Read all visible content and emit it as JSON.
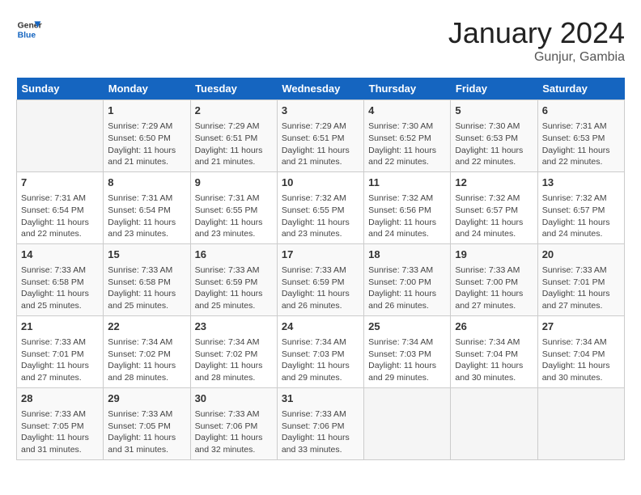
{
  "header": {
    "logo_line1": "General",
    "logo_line2": "Blue",
    "title": "January 2024",
    "subtitle": "Gunjur, Gambia"
  },
  "days_of_week": [
    "Sunday",
    "Monday",
    "Tuesday",
    "Wednesday",
    "Thursday",
    "Friday",
    "Saturday"
  ],
  "weeks": [
    [
      {
        "day": "",
        "content": ""
      },
      {
        "day": "1",
        "content": "Sunrise: 7:29 AM\nSunset: 6:50 PM\nDaylight: 11 hours\nand 21 minutes."
      },
      {
        "day": "2",
        "content": "Sunrise: 7:29 AM\nSunset: 6:51 PM\nDaylight: 11 hours\nand 21 minutes."
      },
      {
        "day": "3",
        "content": "Sunrise: 7:29 AM\nSunset: 6:51 PM\nDaylight: 11 hours\nand 21 minutes."
      },
      {
        "day": "4",
        "content": "Sunrise: 7:30 AM\nSunset: 6:52 PM\nDaylight: 11 hours\nand 22 minutes."
      },
      {
        "day": "5",
        "content": "Sunrise: 7:30 AM\nSunset: 6:53 PM\nDaylight: 11 hours\nand 22 minutes."
      },
      {
        "day": "6",
        "content": "Sunrise: 7:31 AM\nSunset: 6:53 PM\nDaylight: 11 hours\nand 22 minutes."
      }
    ],
    [
      {
        "day": "7",
        "content": "Sunrise: 7:31 AM\nSunset: 6:54 PM\nDaylight: 11 hours\nand 22 minutes."
      },
      {
        "day": "8",
        "content": "Sunrise: 7:31 AM\nSunset: 6:54 PM\nDaylight: 11 hours\nand 23 minutes."
      },
      {
        "day": "9",
        "content": "Sunrise: 7:31 AM\nSunset: 6:55 PM\nDaylight: 11 hours\nand 23 minutes."
      },
      {
        "day": "10",
        "content": "Sunrise: 7:32 AM\nSunset: 6:55 PM\nDaylight: 11 hours\nand 23 minutes."
      },
      {
        "day": "11",
        "content": "Sunrise: 7:32 AM\nSunset: 6:56 PM\nDaylight: 11 hours\nand 24 minutes."
      },
      {
        "day": "12",
        "content": "Sunrise: 7:32 AM\nSunset: 6:57 PM\nDaylight: 11 hours\nand 24 minutes."
      },
      {
        "day": "13",
        "content": "Sunrise: 7:32 AM\nSunset: 6:57 PM\nDaylight: 11 hours\nand 24 minutes."
      }
    ],
    [
      {
        "day": "14",
        "content": "Sunrise: 7:33 AM\nSunset: 6:58 PM\nDaylight: 11 hours\nand 25 minutes."
      },
      {
        "day": "15",
        "content": "Sunrise: 7:33 AM\nSunset: 6:58 PM\nDaylight: 11 hours\nand 25 minutes."
      },
      {
        "day": "16",
        "content": "Sunrise: 7:33 AM\nSunset: 6:59 PM\nDaylight: 11 hours\nand 25 minutes."
      },
      {
        "day": "17",
        "content": "Sunrise: 7:33 AM\nSunset: 6:59 PM\nDaylight: 11 hours\nand 26 minutes."
      },
      {
        "day": "18",
        "content": "Sunrise: 7:33 AM\nSunset: 7:00 PM\nDaylight: 11 hours\nand 26 minutes."
      },
      {
        "day": "19",
        "content": "Sunrise: 7:33 AM\nSunset: 7:00 PM\nDaylight: 11 hours\nand 27 minutes."
      },
      {
        "day": "20",
        "content": "Sunrise: 7:33 AM\nSunset: 7:01 PM\nDaylight: 11 hours\nand 27 minutes."
      }
    ],
    [
      {
        "day": "21",
        "content": "Sunrise: 7:33 AM\nSunset: 7:01 PM\nDaylight: 11 hours\nand 27 minutes."
      },
      {
        "day": "22",
        "content": "Sunrise: 7:34 AM\nSunset: 7:02 PM\nDaylight: 11 hours\nand 28 minutes."
      },
      {
        "day": "23",
        "content": "Sunrise: 7:34 AM\nSunset: 7:02 PM\nDaylight: 11 hours\nand 28 minutes."
      },
      {
        "day": "24",
        "content": "Sunrise: 7:34 AM\nSunset: 7:03 PM\nDaylight: 11 hours\nand 29 minutes."
      },
      {
        "day": "25",
        "content": "Sunrise: 7:34 AM\nSunset: 7:03 PM\nDaylight: 11 hours\nand 29 minutes."
      },
      {
        "day": "26",
        "content": "Sunrise: 7:34 AM\nSunset: 7:04 PM\nDaylight: 11 hours\nand 30 minutes."
      },
      {
        "day": "27",
        "content": "Sunrise: 7:34 AM\nSunset: 7:04 PM\nDaylight: 11 hours\nand 30 minutes."
      }
    ],
    [
      {
        "day": "28",
        "content": "Sunrise: 7:33 AM\nSunset: 7:05 PM\nDaylight: 11 hours\nand 31 minutes."
      },
      {
        "day": "29",
        "content": "Sunrise: 7:33 AM\nSunset: 7:05 PM\nDaylight: 11 hours\nand 31 minutes."
      },
      {
        "day": "30",
        "content": "Sunrise: 7:33 AM\nSunset: 7:06 PM\nDaylight: 11 hours\nand 32 minutes."
      },
      {
        "day": "31",
        "content": "Sunrise: 7:33 AM\nSunset: 7:06 PM\nDaylight: 11 hours\nand 33 minutes."
      },
      {
        "day": "",
        "content": ""
      },
      {
        "day": "",
        "content": ""
      },
      {
        "day": "",
        "content": ""
      }
    ]
  ]
}
